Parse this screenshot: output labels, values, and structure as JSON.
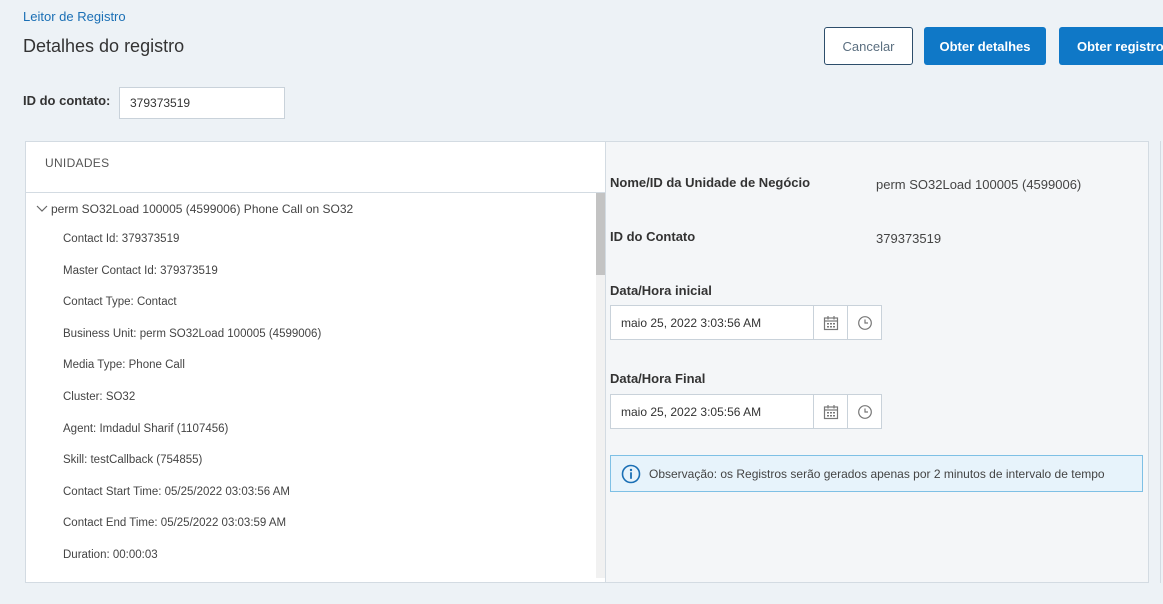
{
  "header": {
    "breadcrumb": "Leitor de Registro",
    "title": "Detalhes do registro",
    "cancel_label": "Cancelar",
    "details_label": "Obter detalhes",
    "registros_label": "Obter registros"
  },
  "contact": {
    "label": "ID do contato:",
    "value": "379373519"
  },
  "units": {
    "title": "UNIDADES",
    "parent_label": "perm SO32Load 100005 (4599006) Phone Call on SO32",
    "items": [
      {
        "label": "Contact Id: 379373519"
      },
      {
        "label": "Master Contact Id: 379373519"
      },
      {
        "label": "Contact Type: Contact"
      },
      {
        "label": "Business Unit: perm SO32Load 100005 (4599006)"
      },
      {
        "label": "Media Type: Phone Call"
      },
      {
        "label": "Cluster: SO32"
      },
      {
        "label": "Agent: Imdadul Sharif (1107456)"
      },
      {
        "label": "Skill: testCallback (754855)"
      },
      {
        "label": "Contact Start Time: 05/25/2022 03:03:56 AM"
      },
      {
        "label": "Contact End Time: 05/25/2022 03:03:59 AM"
      },
      {
        "label": "Duration: 00:00:03"
      }
    ]
  },
  "details": {
    "bu_label": "Nome/ID da Unidade de Negócio",
    "bu_value": "perm SO32Load 100005 (4599006)",
    "contact_label": "ID do Contato",
    "contact_value": "379373519",
    "start_label": "Data/Hora inicial",
    "start_value": "maio 25, 2022 3:03:56 AM",
    "end_label": "Data/Hora Final",
    "end_value": "maio 25, 2022 3:05:56 AM",
    "note": "Observação: os Registros serão gerados apenas por 2 minutos de intervalo de tempo"
  },
  "icons": {
    "calendar": "calendar-icon",
    "clock": "clock-icon",
    "info": "info-icon",
    "chevron": "chevron-down-icon"
  },
  "colors": {
    "primary": "#0f78c7",
    "link": "#1a6fb5",
    "note_bg": "#e7f3fb",
    "note_border": "#7ec0e5",
    "background": "#edf2f6"
  }
}
